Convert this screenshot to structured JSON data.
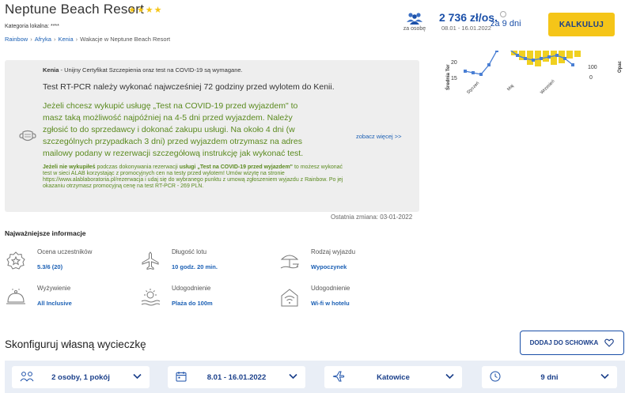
{
  "header": {
    "title": "Neptune Beach Resort",
    "stars": "★★★★",
    "category": "Kategoria lokalna: ****",
    "breadcrumb": [
      "Rainbow",
      "Afryka",
      "Kenia",
      "Wakacje w Neptune Beach Resort"
    ],
    "per_person_label": "za osobę",
    "price": "2 736 zł/os.",
    "price_dates": "08.01 - 16.01.2022",
    "days_label": "za 9 dni",
    "calc_button": "KALKULUJ"
  },
  "covid": {
    "country": "Kenia",
    "head_rest": " - Unijny Certyfikat Szczepienia oraz test na COVID-19 są wymagane.",
    "rt_pcr": "Test RT-PCR należy wykonać najwcześniej 72 godziny przed wylotem do Kenii.",
    "green_text": "Jeżeli chcesz wykupić usługę „Test na COVID-19 przed wyjazdem\" to masz taką możliwość najpóźniej na 4-5 dni przed wyjazdem. Należy zgłosić to do sprzedawcy i dokonać zakupu usługi. Na około 4 dni (w szczególnych przypadkach 3 dni) przed wyjazdem otrzymasz na adres mailowy podany w rezerwacji szczegółową instrukcję jak wykonać test.",
    "small_bold_1": "Jeżeli nie wykupiłeś",
    "small_mid_1": " podczas dokonywania rezerwacji ",
    "small_bold_2": "usługi „Test na COVID-19 przed wyjazdem\"",
    "small_rest": " to możesz wykonać test w sieci ALAB korzystając z promocyjnych cen na testy przed wylotem! Umów wizytę na stronie https://www.alablaboratoria.pl/rezerwacja i udaj się do wybranego punktu z umową zgłoszeniem wyjazdu z Rainbow. Po jej okazaniu otrzymasz promocyjną cenę na test RT-PCR - 269 PLN.",
    "see_more": "zobacz więcej >>",
    "last_change": "Ostatnia zmiana: 03-01-2022"
  },
  "chart_data": {
    "type": "bar",
    "ylabel_left": "Średnia Ter",
    "ylabel_right": "Opac",
    "yticks_left": [
      "20",
      "15"
    ],
    "yticks_right": [
      "100",
      "0"
    ],
    "categories": [
      "Styczeń",
      "Maj",
      "Wrzesień"
    ],
    "colors": {
      "bars": "#f0d020",
      "line": "#4a7fd4"
    }
  },
  "info": {
    "heading": "Najważniejsze informacje",
    "items": [
      {
        "title": "Ocena uczestników",
        "value": "5.3/6 (20)",
        "icon": "rating-badge-icon"
      },
      {
        "title": "Długość lotu",
        "value": "10 godz. 20 min.",
        "icon": "plane-icon"
      },
      {
        "title": "Rodzaj wyjazdu",
        "value": "Wypoczynek",
        "icon": "beach-umbrella-icon"
      },
      {
        "title": "Wyżywienie",
        "value": "All Inclusive",
        "icon": "food-cloche-icon"
      },
      {
        "title": "Udogodnienie",
        "value": "Plaża do 100m",
        "icon": "beach-sun-icon"
      },
      {
        "title": "Udogodnienie",
        "value": "Wi-fi w hotelu",
        "icon": "wifi-house-icon"
      }
    ]
  },
  "config": {
    "title": "Skonfiguruj własną wycieczkę",
    "clipboard_button": "DODAJ DO SCHOWKA",
    "persons": "2 osoby, 1 pokój",
    "dates": "8.01 - 16.01.2022",
    "departure": "Katowice",
    "duration": "9 dni"
  }
}
